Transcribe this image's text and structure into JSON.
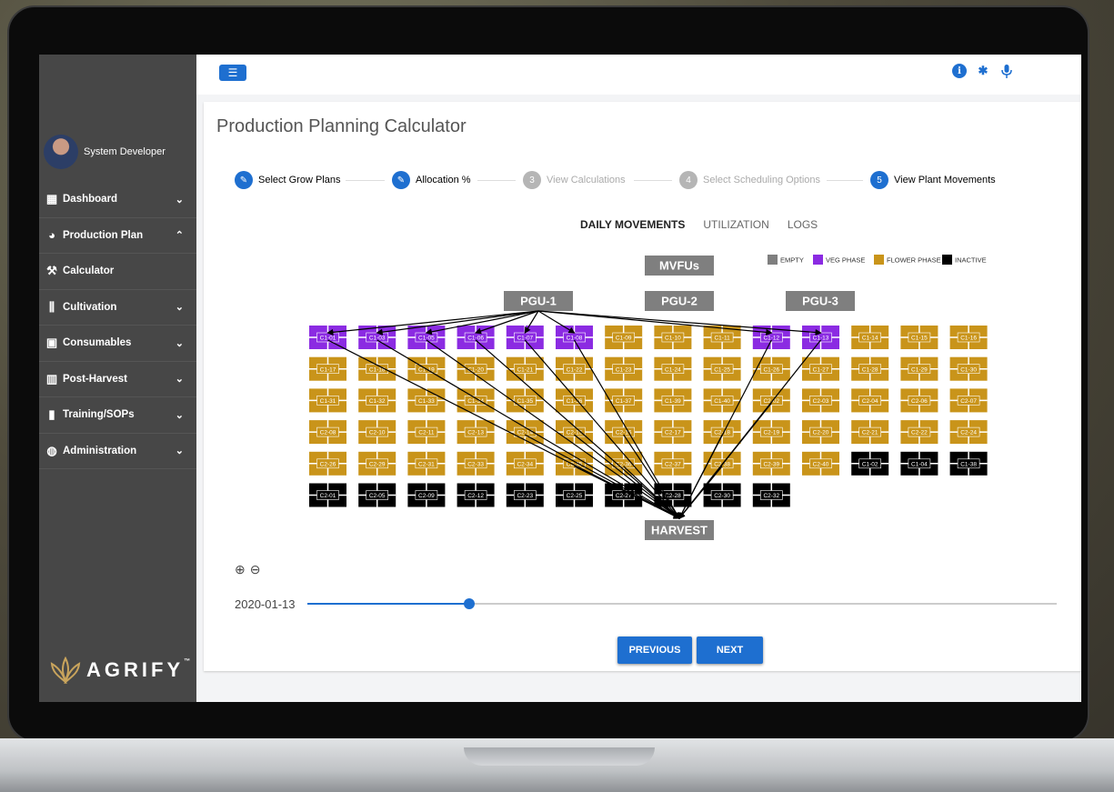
{
  "user": {
    "name": "System Developer"
  },
  "sidebar": {
    "items": [
      {
        "label": "Dashboard",
        "icon": "dashboard-icon",
        "chevron": "⌄"
      },
      {
        "label": "Production Plan",
        "icon": "pie-chart-icon",
        "chevron": "⌃"
      },
      {
        "label": "Calculator",
        "icon": "gavel-icon",
        "chevron": ""
      },
      {
        "label": "Cultivation",
        "icon": "equalizer-icon",
        "chevron": "⌄"
      },
      {
        "label": "Consumables",
        "icon": "trash-bin-icon",
        "chevron": "⌄"
      },
      {
        "label": "Post-Harvest",
        "icon": "bar-chart-icon",
        "chevron": "⌄"
      },
      {
        "label": "Training/SOPs",
        "icon": "book-icon",
        "chevron": "⌄"
      },
      {
        "label": "Administration",
        "icon": "palette-icon",
        "chevron": "⌄"
      }
    ],
    "logo": {
      "text": "AGRIFY",
      "tm": "™"
    }
  },
  "page": {
    "title": "Production Planning Calculator"
  },
  "stepper": [
    {
      "label": "Select Grow Plans",
      "state": "done",
      "num": "✎"
    },
    {
      "label": "Allocation %",
      "state": "done",
      "num": "✎"
    },
    {
      "label": "View Calculations",
      "state": "pending",
      "num": "3"
    },
    {
      "label": "Select Scheduling Options",
      "state": "pending",
      "num": "4"
    },
    {
      "label": "View Plant Movements",
      "state": "active",
      "num": "5"
    }
  ],
  "tabs": {
    "daily": "DAILY MOVEMENTS",
    "util": "UTILIZATION",
    "logs": "LOGS"
  },
  "legend": [
    {
      "label": "EMPTY",
      "color": "#7f7f7f"
    },
    {
      "label": "VEG PHASE",
      "color": "#8b2be2"
    },
    {
      "label": "FLOWER PHASE",
      "color": "#c9941a"
    },
    {
      "label": "INACTIVE",
      "color": "#000000"
    }
  ],
  "labels": {
    "mvfus": "MVFUs",
    "pgu1": "PGU-1",
    "pgu2": "PGU-2",
    "pgu3": "PGU-3",
    "harvest": "HARVEST"
  },
  "grid": [
    [
      [
        "C1-01",
        "veg"
      ],
      [
        "C1-03",
        "veg"
      ],
      [
        "C1-05",
        "veg"
      ],
      [
        "C1-06",
        "veg"
      ],
      [
        "C1-07",
        "veg"
      ],
      [
        "C1-08",
        "veg"
      ],
      [
        "C1-09",
        "flower"
      ],
      [
        "C1-10",
        "flower"
      ],
      [
        "C1-11",
        "flower"
      ],
      [
        "C1-12",
        "veg"
      ],
      [
        "C1-13",
        "veg"
      ],
      [
        "C1-14",
        "flower"
      ],
      [
        "C1-15",
        "flower"
      ],
      [
        "C1-16",
        "flower"
      ]
    ],
    [
      [
        "C1-17",
        "flower"
      ],
      [
        "C1-18",
        "flower"
      ],
      [
        "C1-19",
        "flower"
      ],
      [
        "C1-20",
        "flower"
      ],
      [
        "C1-21",
        "flower"
      ],
      [
        "C1-22",
        "flower"
      ],
      [
        "C1-23",
        "flower"
      ],
      [
        "C1-24",
        "flower"
      ],
      [
        "C1-25",
        "flower"
      ],
      [
        "C1-26",
        "flower"
      ],
      [
        "C1-27",
        "flower"
      ],
      [
        "C1-28",
        "flower"
      ],
      [
        "C1-29",
        "flower"
      ],
      [
        "C1-30",
        "flower"
      ]
    ],
    [
      [
        "C1-31",
        "flower"
      ],
      [
        "C1-32",
        "flower"
      ],
      [
        "C1-33",
        "flower"
      ],
      [
        "C1-34",
        "flower"
      ],
      [
        "C1-35",
        "flower"
      ],
      [
        "C1-36",
        "flower"
      ],
      [
        "C1-37",
        "flower"
      ],
      [
        "C1-39",
        "flower"
      ],
      [
        "C1-40",
        "flower"
      ],
      [
        "C2-02",
        "flower"
      ],
      [
        "C2-03",
        "flower"
      ],
      [
        "C2-04",
        "flower"
      ],
      [
        "C2-06",
        "flower"
      ],
      [
        "C2-07",
        "flower"
      ]
    ],
    [
      [
        "C2-08",
        "flower"
      ],
      [
        "C2-10",
        "flower"
      ],
      [
        "C2-11",
        "flower"
      ],
      [
        "C2-13",
        "flower"
      ],
      [
        "C2-14",
        "flower"
      ],
      [
        "C2-15",
        "flower"
      ],
      [
        "C2-16",
        "flower"
      ],
      [
        "C2-17",
        "flower"
      ],
      [
        "C2-18",
        "flower"
      ],
      [
        "C2-19",
        "flower"
      ],
      [
        "C2-20",
        "flower"
      ],
      [
        "C2-21",
        "flower"
      ],
      [
        "C2-22",
        "flower"
      ],
      [
        "C2-24",
        "flower"
      ]
    ],
    [
      [
        "C2-26",
        "flower"
      ],
      [
        "C2-29",
        "flower"
      ],
      [
        "C2-31",
        "flower"
      ],
      [
        "C2-33",
        "flower"
      ],
      [
        "C2-34",
        "flower"
      ],
      [
        "C2-35",
        "flower"
      ],
      [
        "C2-36",
        "flower"
      ],
      [
        "C2-37",
        "flower"
      ],
      [
        "C2-38",
        "flower"
      ],
      [
        "C2-39",
        "flower"
      ],
      [
        "C2-40",
        "flower"
      ],
      [
        "C1-02",
        "inactive"
      ],
      [
        "C1-04",
        "inactive"
      ],
      [
        "C1-38",
        "inactive"
      ]
    ],
    [
      [
        "C2-01",
        "inactive"
      ],
      [
        "C2-05",
        "inactive"
      ],
      [
        "C2-09",
        "inactive"
      ],
      [
        "C2-12",
        "inactive"
      ],
      [
        "C2-23",
        "inactive"
      ],
      [
        "C2-25",
        "inactive"
      ],
      [
        "C2-27",
        "inactive"
      ],
      [
        "C2-28",
        "inactive"
      ],
      [
        "C2-30",
        "inactive"
      ],
      [
        "C2-32",
        "inactive"
      ]
    ]
  ],
  "pgu1_targets": [
    "C1-01",
    "C1-03",
    "C1-05",
    "C1-06",
    "C1-07",
    "C1-08",
    "C1-12",
    "C1-13"
  ],
  "harvest_sources": [
    "C1-01",
    "C1-03",
    "C1-05",
    "C1-06",
    "C1-07",
    "C1-08",
    "C1-12",
    "C1-13",
    "C2-02",
    "C2-14",
    "C2-15",
    "C2-16",
    "C2-18",
    "C2-35",
    "C2-36",
    "C2-38"
  ],
  "timeline": {
    "date": "2020-01-13",
    "progress": 0.216
  },
  "buttons": {
    "previous": "PREVIOUS",
    "next": "NEXT"
  },
  "colors": {
    "accent": "#1e6fd0",
    "veg": "#8b2be2",
    "flower": "#c9941a",
    "inactive": "#000000",
    "label_box": "#7f7f7f"
  }
}
